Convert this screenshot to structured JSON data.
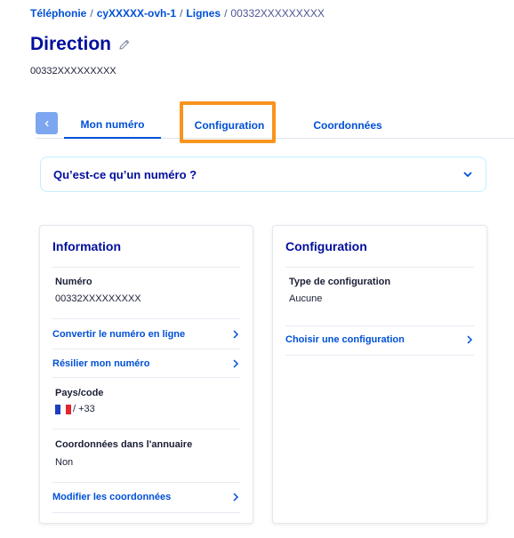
{
  "breadcrumb": {
    "items": [
      "Téléphonie",
      "cyXXXXX-ovh-1",
      "Lignes"
    ],
    "current": "00332XXXXXXXXX",
    "separator": "/"
  },
  "page": {
    "title": "Direction",
    "subtitle": "00332XXXXXXXXX"
  },
  "tabs": {
    "items": [
      "Mon numéro",
      "Configuration",
      "Coordonnées"
    ],
    "active": "Mon numéro",
    "highlighted": "Configuration"
  },
  "accordion": {
    "label": "Qu’est-ce qu’un numéro ?"
  },
  "info_card": {
    "title": "Information",
    "number_label": "Numéro",
    "number_value": "00332XXXXXXXXX",
    "convert_link": "Convertir le numéro en ligne",
    "cancel_link": "Résilier mon numéro",
    "country_label": "Pays/code",
    "country_value": "/ +33",
    "directory_label": "Coordonnées dans l'annuaire",
    "directory_value": "Non",
    "edit_link": "Modifier les coordonnées"
  },
  "config_card": {
    "title": "Configuration",
    "type_label": "Type de configuration",
    "type_value": "Aucune",
    "choose_link": "Choisir une configuration"
  },
  "colors": {
    "primary": "#0050d7",
    "title": "#000e9c",
    "highlight": "#f7941e",
    "tab_back": "#7ca7f0"
  },
  "icons": [
    "pencil-icon",
    "chevron-left-icon",
    "chevron-down-icon",
    "chevron-right-icon",
    "france-flag-icon"
  ]
}
